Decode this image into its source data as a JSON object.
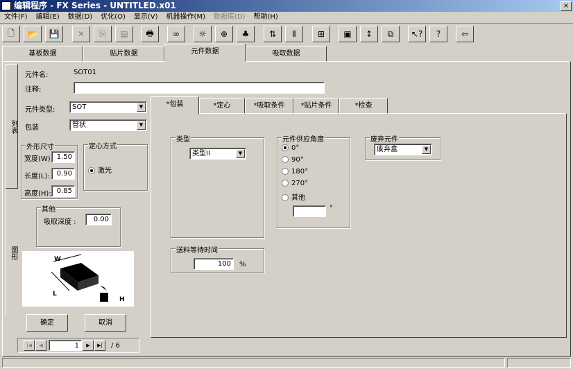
{
  "window": {
    "title": "编辑程序 - FX Series - UNTITLED.x01",
    "close": "×"
  },
  "menu": [
    {
      "label": "文件(F)"
    },
    {
      "label": "编辑(E)"
    },
    {
      "label": "数据(D)"
    },
    {
      "label": "优化(O)"
    },
    {
      "label": "显示(V)"
    },
    {
      "label": "机器操作(M)"
    },
    {
      "label": "数据库(D)",
      "disabled": true
    },
    {
      "label": "帮助(H)"
    }
  ],
  "toolbar": [
    {
      "name": "new-icon",
      "glyph": "🗋"
    },
    {
      "name": "open-icon",
      "glyph": "📂"
    },
    {
      "name": "save-icon",
      "glyph": "💾"
    },
    {
      "name": "cut-icon",
      "glyph": "✕"
    },
    {
      "name": "copy-icon",
      "glyph": "⎘"
    },
    {
      "name": "paste-icon",
      "glyph": "▤"
    },
    {
      "name": "print-icon",
      "glyph": "🖶"
    },
    {
      "name": "find-icon",
      "glyph": "∞"
    },
    {
      "name": "optimize-icon",
      "glyph": "☼"
    },
    {
      "name": "network-icon",
      "glyph": "⊕"
    },
    {
      "name": "shapes-icon",
      "glyph": "♣"
    },
    {
      "name": "transfer-icon",
      "glyph": "⇅"
    },
    {
      "name": "column-icon",
      "glyph": "Ⅱ"
    },
    {
      "name": "machine-icon",
      "glyph": "⊞"
    },
    {
      "name": "stamp-icon",
      "glyph": "▣"
    },
    {
      "name": "height-icon",
      "glyph": "↕"
    },
    {
      "name": "stack-icon",
      "glyph": "⧉"
    },
    {
      "name": "context-help-icon",
      "glyph": "↖?"
    },
    {
      "name": "help-icon",
      "glyph": "?"
    },
    {
      "name": "exit-icon",
      "glyph": "⇦"
    }
  ],
  "main_tabs": [
    "基板数据",
    "贴片数据",
    "元件数据",
    "吸取数据"
  ],
  "side_tabs": [
    "列表",
    "图形"
  ],
  "form": {
    "part_name_label": "元件名:",
    "part_name": "SOT01",
    "comment_label": "注释:",
    "comment": "",
    "part_type_label": "元件类型:",
    "part_type": "SOT",
    "package_label": "包装",
    "package": "管状",
    "dims_title": "外形尺寸",
    "width_label": "宽度(W):",
    "width": "1.50",
    "length_label": "长度(L):",
    "length": "0.90",
    "height_label": "高度(H):",
    "height": "0.85",
    "centering_title": "定心方式",
    "centering_option": "激光",
    "other_title": "其他",
    "pick_depth_label": "吸取深度 :",
    "pick_depth": "0.00",
    "ok": "确定",
    "cancel": "取消"
  },
  "image_labels": {
    "w": "W",
    "l": "L",
    "h": "H"
  },
  "nav": {
    "first": "|◀",
    "prev": "◀",
    "current": "1",
    "next": "▶",
    "last": "▶|",
    "total": "/ 6"
  },
  "sub_tabs": [
    "*包装",
    "*定心",
    "*吸取条件",
    "*贴片条件",
    "*检查"
  ],
  "package_tab": {
    "type_title": "类型",
    "type_value": "类型II",
    "angle_title": "元件供应角度",
    "angles": [
      "0°",
      "90°",
      "180°",
      "270°",
      "其他"
    ],
    "angle_selected": 0,
    "other_angle": "",
    "degree_unit": "°",
    "discard_title": "废弃元件",
    "discard_value": "废弃盒",
    "feed_title": "送料等待时间",
    "feed_value": "100",
    "feed_unit": "%"
  }
}
